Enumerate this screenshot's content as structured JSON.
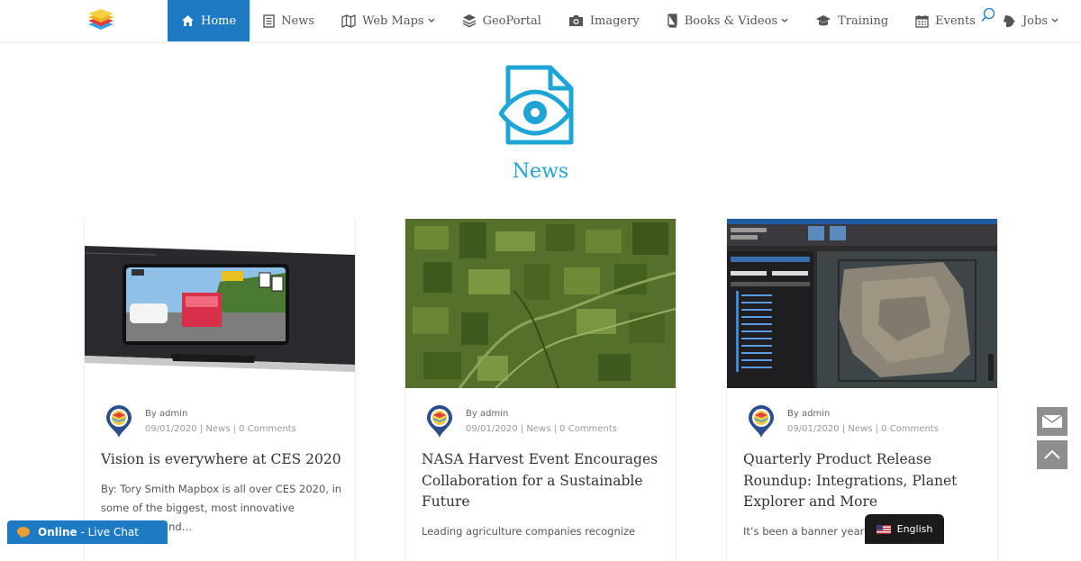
{
  "nav": {
    "items": [
      {
        "label": "Home",
        "icon": "home-icon",
        "active": true
      },
      {
        "label": "News",
        "icon": "newspaper-icon"
      },
      {
        "label": "Web Maps",
        "icon": "map-icon",
        "dropdown": true
      },
      {
        "label": "GeoPortal",
        "icon": "layers-icon"
      },
      {
        "label": "Imagery",
        "icon": "camera-icon"
      },
      {
        "label": "Books & Videos",
        "icon": "book-icon",
        "dropdown": true
      },
      {
        "label": "Training",
        "icon": "graduation-cap-icon"
      },
      {
        "label": "Events",
        "icon": "calendar-icon"
      },
      {
        "label": "Jobs",
        "icon": "briefcase-icon",
        "dropdown": true
      }
    ]
  },
  "page": {
    "title": "News"
  },
  "posts": [
    {
      "author": "By admin",
      "date": "09/01/2020",
      "category": "News",
      "comments": "0 Comments",
      "title": "Vision is everywhere at CES 2020",
      "excerpt": "By: Tory Smith Mapbox is all over CES 2020, in some of the biggest, most innovative navigation, and…",
      "image": "dashboard-display-photo"
    },
    {
      "author": "By admin",
      "date": "09/01/2020",
      "category": "News",
      "comments": "0 Comments",
      "title": "NASA Harvest Event Encourages Collaboration for a Sustainable Future",
      "excerpt": "Leading agriculture companies recognize",
      "image": "satellite-farmland-photo"
    },
    {
      "author": "By admin",
      "date": "09/01/2020",
      "category": "News",
      "comments": "0 Comments",
      "title": "Quarterly Product Release Roundup: Integrations, Planet Explorer and More",
      "excerpt": "It’s been a banner year releases,",
      "image": "gis-software-screenshot"
    }
  ],
  "chat": {
    "status": "Online",
    "label": "Live Chat"
  },
  "language": {
    "label": "English"
  },
  "colors": {
    "accent": "#1f7ac4",
    "title": "#1fa4d6"
  }
}
